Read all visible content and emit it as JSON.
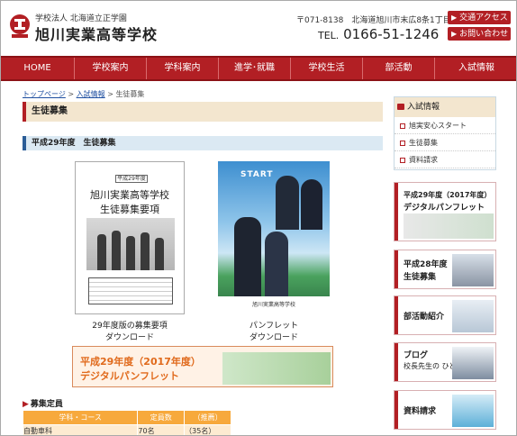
{
  "header": {
    "school_sub": "学校法人 北海道立正学園",
    "school_name": "旭川実業高等学校",
    "address": "〒071-8138　北海道旭川市末広8条1丁目",
    "tel_label": "TEL.",
    "tel_number": "0166-51-1246",
    "access_button": "交通アクセス",
    "contact_button": "お問い合わせ",
    "brand_color": "#b21f24"
  },
  "nav": {
    "items": [
      {
        "label": "HOME"
      },
      {
        "label": "学校案内"
      },
      {
        "label": "学科案内"
      },
      {
        "label": "進学･就職"
      },
      {
        "label": "学校生活"
      },
      {
        "label": "部活動"
      },
      {
        "label": "入試情報"
      }
    ]
  },
  "breadcrumb": {
    "top": "トップページ",
    "sep1": ">",
    "exam": "入試情報",
    "sep2": ">",
    "current": "生徒募集"
  },
  "main": {
    "section_title": "生徒募集",
    "sub_title": "平成29年度　生徒募集",
    "booklet": {
      "tag": "平成29年度",
      "title1": "旭川実業高等学校",
      "title2": "生徒募集要項",
      "caption1": "29年度版の募集要項",
      "caption2": "ダウンロード"
    },
    "pamphlet": {
      "cover_word": "START",
      "cover_footer": "旭川実業高等学校",
      "caption1": "パンフレット",
      "caption2": "ダウンロード"
    },
    "wide_banner": {
      "line1": "平成29年度（2017年度）",
      "line2": "デジタルパンフレット"
    },
    "quota": {
      "heading": "募集定員",
      "headers": [
        "学科・コース",
        "定員数",
        "（推薦）"
      ],
      "rows": [
        [
          "自動車科",
          "70名",
          "（35名）"
        ]
      ]
    }
  },
  "sidebar": {
    "box_title": "入試情報",
    "items": [
      {
        "label": "旭実安心スタート"
      },
      {
        "label": "生徒募集"
      },
      {
        "label": "資料請求"
      }
    ],
    "banners": [
      {
        "line1": "平成29年度（2017年度）",
        "line2": "デジタルパンフレット"
      },
      {
        "line1": "平成28年度",
        "line2": "生徒募集"
      },
      {
        "line1": "部活動紹介",
        "line2": ""
      },
      {
        "line1": "ブログ",
        "line2": "校長先生の ひとりごと"
      },
      {
        "line1": "資料請求",
        "line2": ""
      }
    ]
  }
}
